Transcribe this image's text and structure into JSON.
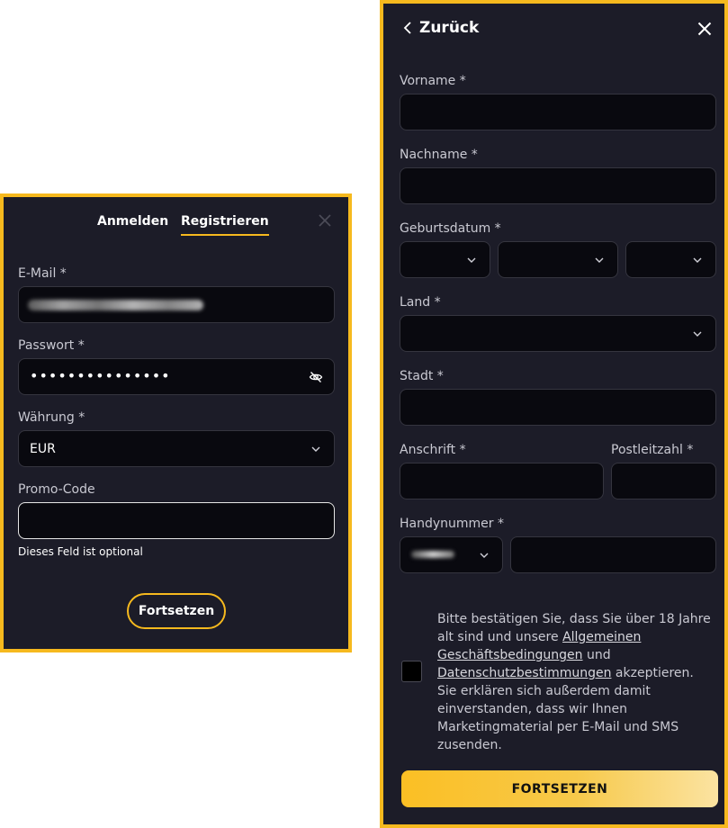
{
  "login": {
    "tabs": [
      {
        "label": "Anmelden"
      },
      {
        "label": "Registrieren"
      }
    ],
    "email_label": "E-Mail *",
    "password_label": "Passwort *",
    "password_value": "•••••••••••••••",
    "currency_label": "Währung *",
    "currency_value": "EUR",
    "promo_label": "Promo-Code",
    "promo_hint": "Dieses Feld ist optional",
    "continue_label": "Fortsetzen"
  },
  "register": {
    "back_label": "Zurück",
    "first_name_label": "Vorname *",
    "last_name_label": "Nachname *",
    "birthdate_label": "Geburtsdatum *",
    "country_label": "Land *",
    "city_label": "Stadt *",
    "address_label": "Anschrift *",
    "postcode_label": "Postleitzahl *",
    "phone_label": "Handynummer *",
    "terms": {
      "text_1": "Bitte bestätigen Sie, dass Sie über 18 Jahre alt sind und unsere ",
      "link_1": "Allgemeinen Geschäftsbedingungen",
      "text_2": " und ",
      "link_2": "Datenschutzbestimmungen",
      "text_3": " akzeptieren. Sie erklären sich außerdem damit einverstanden, dass wir Ihnen Marketingmaterial per E-Mail und SMS zusenden."
    },
    "continue_label": "FORTSETZEN"
  },
  "colors": {
    "accent": "#f6b91e",
    "panel_bg": "#1c1c28",
    "input_bg": "#09090f"
  }
}
